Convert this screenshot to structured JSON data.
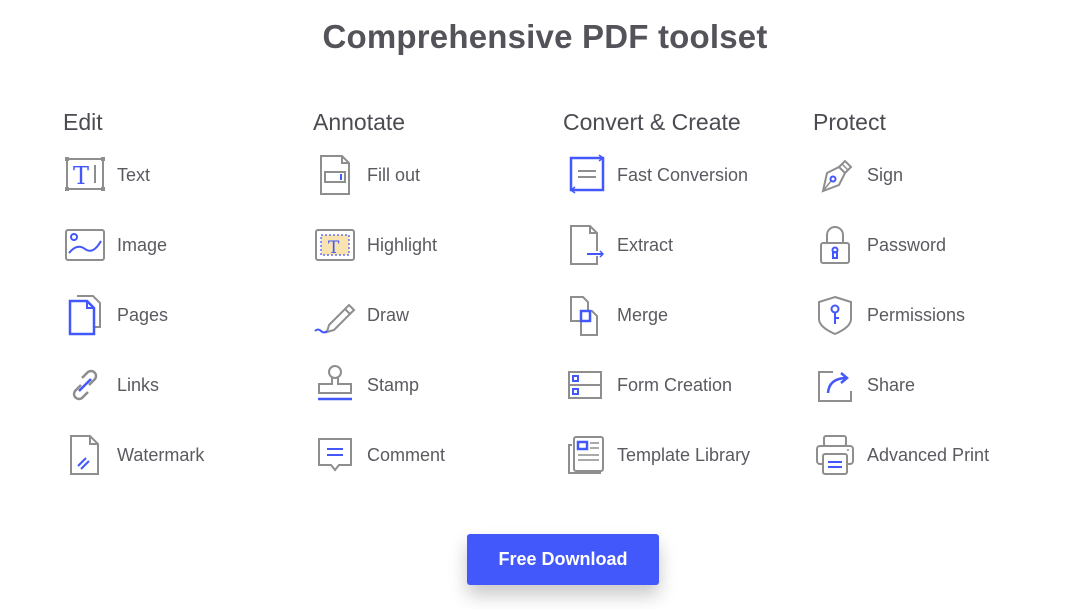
{
  "page": {
    "title": "Comprehensive PDF toolset"
  },
  "colors": {
    "accent": "#4358fb",
    "icon_gray": "#8e8e8e",
    "highlight": "#f9e3b0"
  },
  "columns": [
    {
      "heading": "Edit",
      "items": [
        {
          "label": "Text",
          "icon": "text-box-icon"
        },
        {
          "label": "Image",
          "icon": "image-icon"
        },
        {
          "label": "Pages",
          "icon": "pages-icon"
        },
        {
          "label": "Links",
          "icon": "link-icon"
        },
        {
          "label": "Watermark",
          "icon": "watermark-icon"
        }
      ]
    },
    {
      "heading": "Annotate",
      "items": [
        {
          "label": "Fill out",
          "icon": "fill-out-icon"
        },
        {
          "label": "Highlight",
          "icon": "highlight-icon"
        },
        {
          "label": "Draw",
          "icon": "pencil-icon"
        },
        {
          "label": "Stamp",
          "icon": "stamp-icon"
        },
        {
          "label": "Comment",
          "icon": "comment-icon"
        }
      ]
    },
    {
      "heading": "Convert & Create",
      "items": [
        {
          "label": "Fast Conversion",
          "icon": "conversion-icon"
        },
        {
          "label": "Extract",
          "icon": "extract-icon"
        },
        {
          "label": "Merge",
          "icon": "merge-icon"
        },
        {
          "label": "Form Creation",
          "icon": "form-icon"
        },
        {
          "label": "Template Library",
          "icon": "template-icon"
        }
      ]
    },
    {
      "heading": "Protect",
      "items": [
        {
          "label": "Sign",
          "icon": "pen-nib-icon"
        },
        {
          "label": "Password",
          "icon": "lock-icon"
        },
        {
          "label": "Permissions",
          "icon": "shield-key-icon"
        },
        {
          "label": "Share",
          "icon": "share-icon"
        },
        {
          "label": "Advanced Print",
          "icon": "printer-icon"
        }
      ]
    }
  ],
  "cta": {
    "label": "Free Download"
  }
}
